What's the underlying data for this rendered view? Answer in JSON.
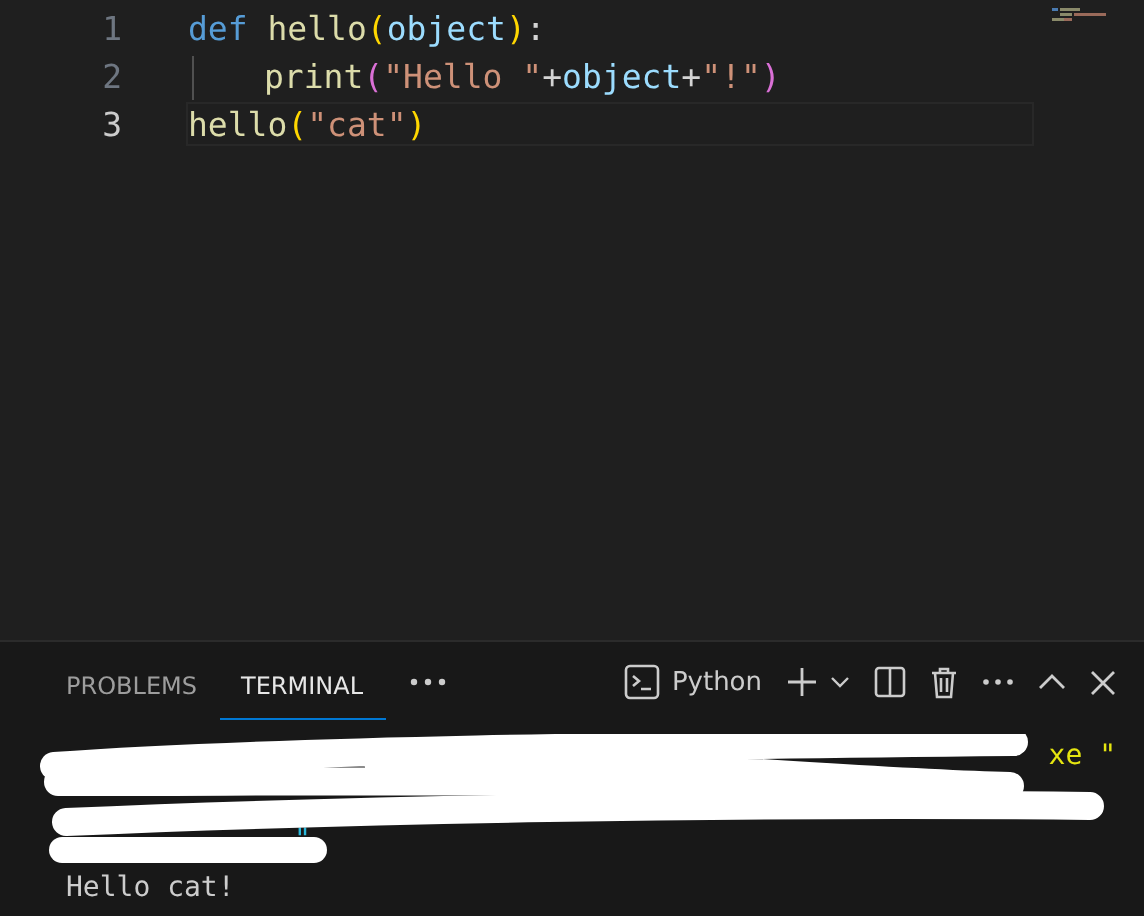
{
  "editor": {
    "lines": [
      {
        "number": "1",
        "current": false,
        "indent": false,
        "tokens": [
          {
            "text": "def ",
            "kind": "keyword"
          },
          {
            "text": "hello",
            "kind": "function"
          },
          {
            "text": "(",
            "kind": "bracket"
          },
          {
            "text": "object",
            "kind": "variable"
          },
          {
            "text": ")",
            "kind": "bracket"
          },
          {
            "text": ":",
            "kind": "plain"
          }
        ]
      },
      {
        "number": "2",
        "current": false,
        "indent": true,
        "tokens": [
          {
            "text": "print",
            "kind": "function"
          },
          {
            "text": "(",
            "kind": "bracket2"
          },
          {
            "text": "\"Hello \"",
            "kind": "string"
          },
          {
            "text": "+",
            "kind": "plain"
          },
          {
            "text": "object",
            "kind": "variable"
          },
          {
            "text": "+",
            "kind": "plain"
          },
          {
            "text": "\"!\"",
            "kind": "string"
          },
          {
            "text": ")",
            "kind": "bracket2"
          }
        ]
      },
      {
        "number": "3",
        "current": true,
        "indent": false,
        "tokens": [
          {
            "text": "hello",
            "kind": "function"
          },
          {
            "text": "(",
            "kind": "bracket"
          },
          {
            "text": "\"cat\"",
            "kind": "string"
          },
          {
            "text": ")",
            "kind": "bracket"
          }
        ]
      }
    ]
  },
  "panel": {
    "tabs": [
      {
        "label": "PROBLEMS",
        "selected": false
      },
      {
        "label": "TERMINAL",
        "selected": true
      }
    ],
    "terminal_name": "Python",
    "terminal": {
      "redacted_tail": "xe \"",
      "redacted_end": "\"",
      "output": "Hello cat!"
    }
  }
}
